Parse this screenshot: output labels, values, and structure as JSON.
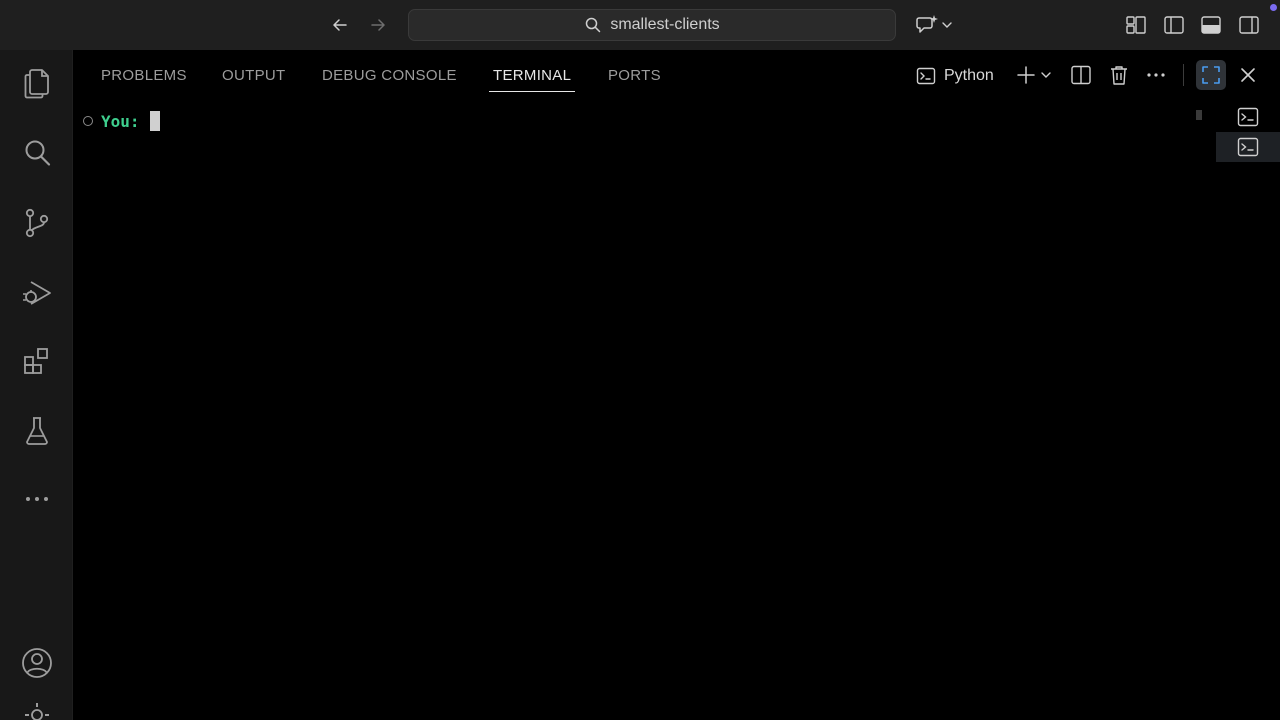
{
  "titlebar": {
    "search_text": "smallest-clients"
  },
  "panel": {
    "tabs": [
      {
        "label": "PROBLEMS",
        "active": false
      },
      {
        "label": "OUTPUT",
        "active": false
      },
      {
        "label": "DEBUG CONSOLE",
        "active": false
      },
      {
        "label": "TERMINAL",
        "active": true
      },
      {
        "label": "PORTS",
        "active": false
      }
    ],
    "terminal_name": "Python"
  },
  "terminal": {
    "prompt": "You:"
  },
  "colors": {
    "prompt_green": "#3ecf8e",
    "accent_purple": "#7b6cf0",
    "background": "#000000"
  },
  "icons": {
    "activity_bar": [
      "files-icon",
      "search-icon",
      "source-control-icon",
      "run-debug-icon",
      "extensions-icon",
      "testing-icon",
      "more-icon",
      "account-icon"
    ]
  }
}
